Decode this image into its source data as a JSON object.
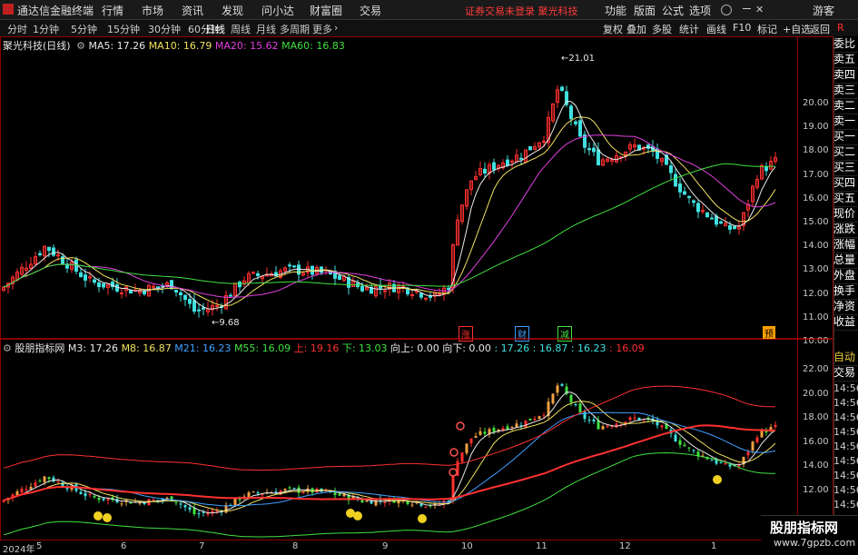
{
  "menubar": {
    "app_name": "通达信金融终端",
    "menus": [
      "行情",
      "市场",
      "资讯",
      "发现",
      "问小达",
      "财富圈",
      "交易"
    ],
    "notice": "证券交易未登录  聚光科技",
    "right_menus": [
      "功能",
      "版面",
      "公式",
      "选项"
    ],
    "guest": "游客"
  },
  "periods": [
    "分时",
    "1分钟",
    "5分钟",
    "15分钟",
    "30分钟",
    "60分钟",
    "日线",
    "周线",
    "月线",
    "多周期",
    "更多"
  ],
  "active_period": "日线",
  "toolbar": [
    "复权",
    "叠加",
    "多股",
    "统计",
    "画线",
    "F10",
    "标记",
    "+自选",
    "返回"
  ],
  "main_chart": {
    "title": "聚光科技(日线)",
    "legend": [
      {
        "text": "MA5: 17.26",
        "color": "#e8e8e8"
      },
      {
        "text": "MA10: 16.79",
        "color": "#f0e060"
      },
      {
        "text": "MA20: 15.62",
        "color": "#e040e0"
      },
      {
        "text": "MA60: 16.83",
        "color": "#40e040"
      }
    ],
    "high_label": "21.01",
    "low_label": "9.68",
    "ytick_labels": [
      "20.00",
      "19.00",
      "18.00",
      "17.00",
      "16.00",
      "15.00",
      "14.00",
      "13.00",
      "12.00",
      "11.00",
      "10.00"
    ],
    "badges": [
      {
        "text": "涨",
        "color": "#ff3030"
      },
      {
        "text": "财",
        "color": "#40a0ff"
      },
      {
        "text": "减",
        "color": "#40e040"
      },
      {
        "text": "预",
        "color": "#ffa000"
      }
    ]
  },
  "sub_chart": {
    "title": "股朋指标网",
    "legend": [
      {
        "text": "M3: 17.26",
        "color": "#e8e8e8"
      },
      {
        "text": "M8: 16.87",
        "color": "#f0e060"
      },
      {
        "text": "M21: 16.23",
        "color": "#40a0ff"
      },
      {
        "text": "M55: 16.09",
        "color": "#40e040"
      },
      {
        "text": "上: 19.16",
        "color": "#ff3030"
      },
      {
        "text": "下: 13.03",
        "color": "#40e040"
      },
      {
        "text": "向上: 0.00",
        "color": "#e8e8e8"
      },
      {
        "text": "向下: 0.00",
        "color": "#e8e8e8"
      },
      {
        "text": ": 17.26",
        "color": "#40e0e0"
      },
      {
        "text": ": 16.87",
        "color": "#40e0e0"
      },
      {
        "text": ": 16.23",
        "color": "#40e0e0"
      },
      {
        "text": ": 16.09",
        "color": "#ff3030"
      }
    ],
    "ytick_labels": [
      "22.00",
      "20.00",
      "18.00",
      "16.00",
      "14.00",
      "12.00"
    ]
  },
  "xaxis": {
    "year_label": "2024年",
    "months": [
      "5",
      "6",
      "7",
      "8",
      "9",
      "10",
      "11",
      "12",
      "1"
    ]
  },
  "right_panel": {
    "rows": [
      "委比",
      "卖五",
      "卖四",
      "卖三",
      "卖二",
      "卖一",
      "买一",
      "买二",
      "买三",
      "买四",
      "买五",
      "现价",
      "涨跌",
      "涨幅",
      "总量",
      "外盘",
      "换手",
      "净资",
      "收益"
    ],
    "tabs": [
      "自动",
      "交易"
    ],
    "times": [
      "14:56",
      "14:56",
      "14:56",
      "14:56",
      "14:56",
      "14:56",
      "14:56",
      "14:56",
      "14:56",
      "14:56"
    ]
  },
  "watermark": {
    "line1": "股朋指标网",
    "line2": "www.7gpzb.com"
  },
  "colors": {
    "up": "#ff3030",
    "down": "#40e0e0",
    "frame": "#8b0000",
    "bg": "#000000"
  },
  "top_right_flag": "R"
}
